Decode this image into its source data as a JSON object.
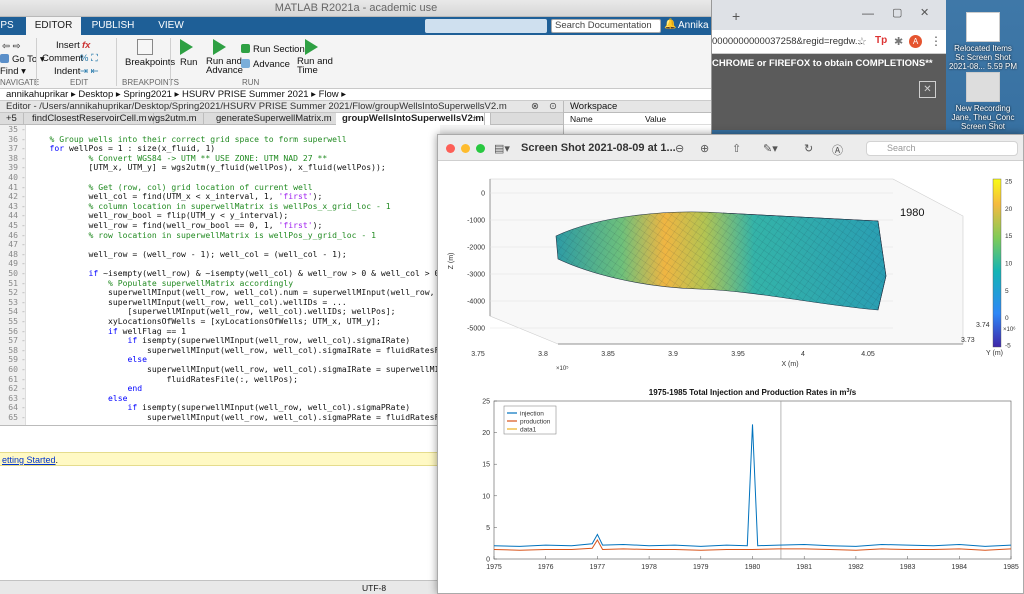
{
  "matlab": {
    "title": "MATLAB R2021a - academic use",
    "tabs": [
      "PS",
      "EDITOR",
      "PUBLISH",
      "VIEW"
    ],
    "search_placeholder": "Search Documentation",
    "user": "Annika",
    "ribbon": {
      "navigate": {
        "goto": "Go To",
        "find": "Find",
        "section": "NAVIGATE"
      },
      "edit": {
        "insert": "Insert",
        "comment": "Comment",
        "indent": "Indent",
        "section": "EDIT",
        "fx": "fx"
      },
      "breakpoints": {
        "label": "Breakpoints",
        "section": "BREAKPOINTS"
      },
      "run": {
        "run": "Run",
        "run_advance": "Run and\nAdvance",
        "run_section": "Run Section",
        "advance": "Advance",
        "run_time": "Run and\nTime",
        "section": "RUN"
      }
    },
    "path": [
      "annikahuprikar",
      "Desktop",
      "Spring2021",
      "HSURV PRISE Summer 2021",
      "Flow"
    ],
    "editor_header": "Editor - /Users/annikahuprikar/Desktop/Spring2021/HSURV PRISE Summer 2021/Flow/groupWellsIntoSuperwellsV2.m",
    "file_tabs": [
      "+5",
      "findClosestReservoirCell.m",
      "wgs2utm.m",
      "generateSuperwellMatrix.m",
      "groupWellsIntoSuperwellsV2.m"
    ],
    "active_tab": "groupWellsIntoSuperwellsV2.m",
    "workspace": {
      "title": "Workspace",
      "col_name": "Name",
      "col_value": "Value"
    },
    "code_lines": [
      {
        "n": "35",
        "t": ""
      },
      {
        "n": "36",
        "t": "    % Group wells into their correct grid space to form superwell"
      },
      {
        "n": "37",
        "t": "    for wellPos = 1 : size(x_fluid, 1)"
      },
      {
        "n": "38",
        "t": "            % Convert WGS84 -> UTM ** USE ZONE: UTM NAD 27 **"
      },
      {
        "n": "39",
        "t": "            [UTM_x, UTM_y] = wgs2utm(y_fluid(wellPos), x_fluid(wellPos));"
      },
      {
        "n": "40",
        "t": ""
      },
      {
        "n": "41",
        "t": "            % Get (row, col) grid location of current well"
      },
      {
        "n": "42",
        "t": "            well_col = find(UTM_x < x_interval, 1, 'first');"
      },
      {
        "n": "43",
        "t": "            % column location in superwellMatrix is wellPos_x_grid_loc - 1"
      },
      {
        "n": "44",
        "t": "            well_row_bool = flip(UTM_y < y_interval);"
      },
      {
        "n": "45",
        "t": "            well_row = find(well_row_bool == 0, 1, 'first');"
      },
      {
        "n": "46",
        "t": "            % row location in superwellMatrix is wellPos_y_grid_loc - 1"
      },
      {
        "n": "47",
        "t": ""
      },
      {
        "n": "48",
        "t": "            well_row = (well_row - 1); well_col = (well_col - 1);"
      },
      {
        "n": "49",
        "t": ""
      },
      {
        "n": "50",
        "t": "            if ~isempty(well_row) & ~isempty(well_col) & well_row > 0 & well_col > 0"
      },
      {
        "n": "51",
        "t": "                % Populate superwellMatrix accordingly"
      },
      {
        "n": "52",
        "t": "                superwellMInput(well_row, well_col).num = superwellMInput(well_row, well_co"
      },
      {
        "n": "53",
        "t": "                superwellMInput(well_row, well_col).wellIDs = ..."
      },
      {
        "n": "54",
        "t": "                    [superwellMInput(well_row, well_col).wellIDs; wellPos];"
      },
      {
        "n": "55",
        "t": "                xyLocationsOfWells = [xyLocationsOfWells; UTM_x, UTM_y];"
      },
      {
        "n": "56",
        "t": "                if wellFlag == 1"
      },
      {
        "n": "57",
        "t": "                    if isempty(superwellMInput(well_row, well_col).sigmaIRate)"
      },
      {
        "n": "58",
        "t": "                        superwellMInput(well_row, well_col).sigmaIRate = fluidRatesFile(:,"
      },
      {
        "n": "59",
        "t": "                    else"
      },
      {
        "n": "60",
        "t": "                        superwellMInput(well_row, well_col).sigmaIRate = superwellMInput(w"
      },
      {
        "n": "61",
        "t": "                            fluidRatesFile(:, wellPos);"
      },
      {
        "n": "62",
        "t": "                    end"
      },
      {
        "n": "63",
        "t": "                else"
      },
      {
        "n": "64",
        "t": "                    if isempty(superwellMInput(well_row, well_col).sigmaPRate)"
      },
      {
        "n": "65",
        "t": "                        superwellMInput(well_row, well_col).sigmaPRate = fluidRatesFile(:,"
      }
    ],
    "command_link": "etting Started",
    "command_suffix": ".",
    "status_encoding": "UTF-8"
  },
  "chrome": {
    "url": "0000000000037258&regid=regdw...",
    "banner": "CHROME or FIREFOX to obtain COMPLETIONS**",
    "close_label": "✕"
  },
  "desktop_icons": [
    {
      "label": "Relocated Items"
    },
    {
      "label": "Sc Screen Shot 2021-08... 5.59 PM"
    },
    {
      "label": "New Recording Jane, Theu_Conc"
    },
    {
      "label": "Screen Shot"
    }
  ],
  "preview": {
    "title": "Screen Shot 2021-08-09 at 1...",
    "search_placeholder": "Search"
  },
  "colors": {
    "matlab_blue": "#1e5f97",
    "injection": "#0072bd",
    "production": "#d95319",
    "data1": "#edb120"
  },
  "chart_data": [
    {
      "type": "surface",
      "annotation": "1980",
      "zlabel": "Z (m)",
      "xlabel": "X (m)",
      "ylabel": "Y (m)",
      "x_ticks": [
        "3.75",
        "3.8",
        "3.85",
        "3.9",
        "3.95",
        "4",
        "4.05"
      ],
      "x_multiplier": "×10⁵",
      "z_ticks": [
        "0",
        "-1000",
        "-2000",
        "-3000",
        "-4000",
        "-5000"
      ],
      "y_ticks": [
        "3.73",
        "3.74"
      ],
      "y_multiplier": "×10⁶",
      "colorbar_ticks": [
        "25",
        "20",
        "15",
        "10",
        "5",
        "0",
        "-5"
      ],
      "colorbar_range": [
        -5,
        25
      ]
    },
    {
      "type": "line",
      "title": "1975-1985 Total Injection and Production Rates in m³/s",
      "title_plain": "1975-1985 Total Injection and Production Rates in m",
      "title_sup": "3",
      "title_end": "/s",
      "x_ticks": [
        "1975",
        "1976",
        "1977",
        "1978",
        "1979",
        "1980",
        "1981",
        "1982",
        "1983",
        "1984",
        "1985"
      ],
      "y_ticks": [
        "25",
        "20",
        "15",
        "10",
        "5",
        "0"
      ],
      "xlim": [
        1975,
        1985
      ],
      "ylim": [
        0,
        25
      ],
      "legend": [
        "injection",
        "production",
        "data1"
      ],
      "legend_position": "top-left",
      "vertical_line_x": 1980.55,
      "series": [
        {
          "name": "injection",
          "x": [
            1975,
            1975.5,
            1976,
            1976.5,
            1976.9,
            1977.0,
            1977.1,
            1977.5,
            1978,
            1978.5,
            1979,
            1979.5,
            1979.9,
            1980.0,
            1980.1,
            1980.5,
            1981,
            1981.5,
            1982,
            1982.5,
            1983,
            1983.5,
            1984,
            1984.5,
            1985
          ],
          "y": [
            2.1,
            2.0,
            2.2,
            2.1,
            2.4,
            3.9,
            2.2,
            2.3,
            2.1,
            2.2,
            2.0,
            2.2,
            2.1,
            21.3,
            2.1,
            2.2,
            2.3,
            2.1,
            2.0,
            2.3,
            2.2,
            2.1,
            2.3,
            2.0,
            2.2
          ]
        },
        {
          "name": "production",
          "x": [
            1975,
            1975.5,
            1976,
            1976.5,
            1976.9,
            1977.0,
            1977.1,
            1977.5,
            1978,
            1978.5,
            1979,
            1979.5,
            1980,
            1980.5,
            1981,
            1981.5,
            1982,
            1982.5,
            1983,
            1983.5,
            1984,
            1984.5,
            1985
          ],
          "y": [
            1.5,
            1.4,
            1.5,
            1.5,
            1.7,
            3.0,
            1.5,
            1.6,
            1.5,
            1.5,
            1.4,
            1.5,
            1.5,
            1.6,
            1.6,
            1.5,
            1.4,
            1.6,
            1.5,
            1.5,
            1.6,
            1.4,
            1.6
          ]
        }
      ]
    }
  ]
}
